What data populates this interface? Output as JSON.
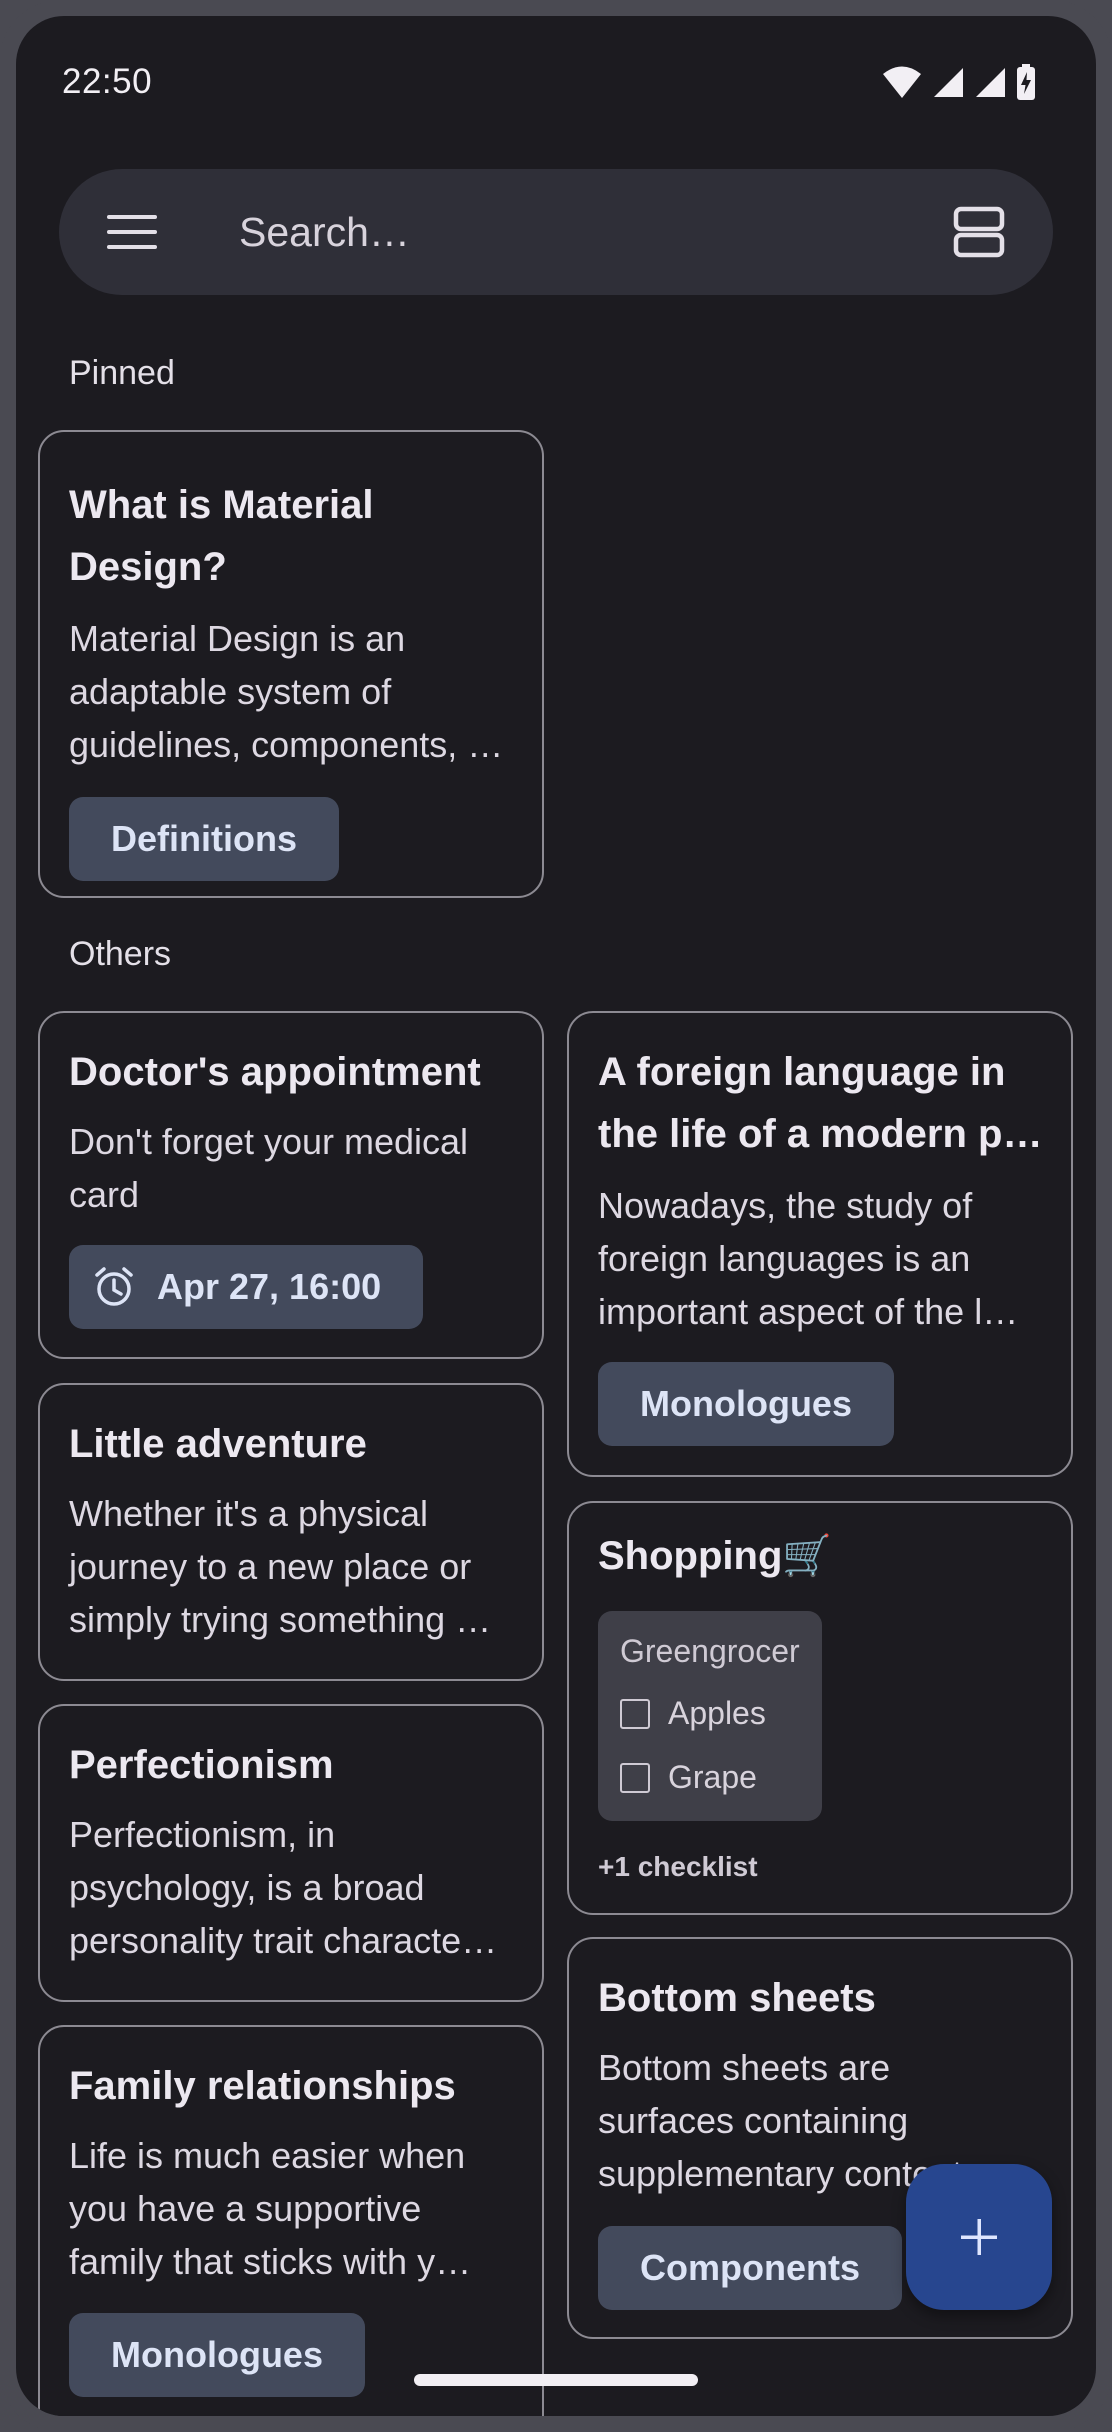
{
  "status_bar": {
    "time": "22:50",
    "icons": [
      "wifi-icon",
      "signal-icon",
      "signal-icon",
      "battery-charging-icon"
    ]
  },
  "search": {
    "placeholder": "Search…",
    "menu_icon": "hamburger-menu-icon",
    "layout_icon": "list-layout-icon"
  },
  "sections": {
    "pinned": "Pinned",
    "others": "Others"
  },
  "pinned_notes": [
    {
      "title_lines": [
        "What is Material",
        "Design?"
      ],
      "body_lines": [
        "Material Design is an",
        "adaptable system of",
        "guidelines, components, …"
      ],
      "label": "Definitions"
    }
  ],
  "notes": {
    "doctor": {
      "title": "Doctor's appointment",
      "body_lines": [
        "Don't forget your medical",
        "card"
      ],
      "reminder": "Apr 27, 16:00",
      "reminder_icon": "alarm-clock-icon"
    },
    "foreign": {
      "title_lines": [
        "A foreign language in",
        "the life of a modern p…"
      ],
      "body_lines": [
        "Nowadays, the study of",
        "foreign languages is an",
        "important aspect of the l…"
      ],
      "label": "Monologues"
    },
    "adventure": {
      "title": "Little adventure",
      "body_lines": [
        "Whether it's a physical",
        "journey to a new place or",
        "simply trying something …"
      ]
    },
    "shopping": {
      "title": "Shopping🛒",
      "checklist_title": "Greengrocer",
      "items": [
        "Apples",
        "Grape"
      ],
      "more": "+1 checklist"
    },
    "perfectionism": {
      "title": "Perfectionism",
      "body_lines": [
        "Perfectionism, in",
        "psychology, is a broad",
        "personality trait characte…"
      ]
    },
    "bottom_sheets": {
      "title": "Bottom sheets",
      "body_lines": [
        "Bottom sheets are",
        "surfaces containing",
        "supplementary content"
      ],
      "label": "Components"
    },
    "family": {
      "title": "Family relationships",
      "body_lines": [
        "Life is much easier when",
        "you have a supportive",
        "family that sticks with y…"
      ],
      "label": "Monologues"
    }
  },
  "fab": {
    "icon": "plus-icon"
  },
  "colors": {
    "background": "#1c1b20",
    "surface": "#2f2f38",
    "chip": "#434a5c",
    "fab": "#27468f",
    "outline": "#8c8a92"
  }
}
